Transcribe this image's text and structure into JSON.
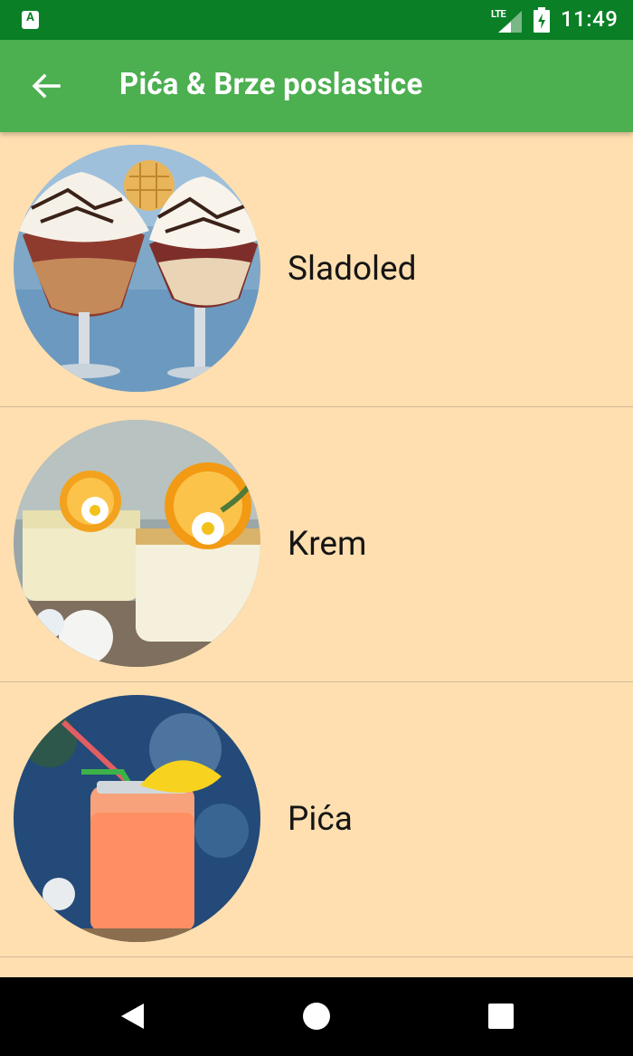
{
  "status_bar": {
    "network": "LTE",
    "time": "11:49",
    "notification_icon": "A"
  },
  "app_bar": {
    "title": "Pića & Brze poslastice",
    "back_icon": "arrow-left-icon"
  },
  "list": {
    "items": [
      {
        "label": "Sladoled",
        "image": "ice-cream-sundae"
      },
      {
        "label": "Krem",
        "image": "cream-dessert-cups"
      },
      {
        "label": "Pića",
        "image": "orange-drink-jar"
      }
    ]
  },
  "nav_bar": {
    "buttons": [
      "back-triangle-icon",
      "home-circle-icon",
      "recents-square-icon"
    ]
  },
  "colors": {
    "status_bar": "#0A7F26",
    "app_bar": "#4CAF50",
    "background": "#FFDFB0",
    "divider": "#D2B999",
    "nav_bar": "#000000"
  }
}
